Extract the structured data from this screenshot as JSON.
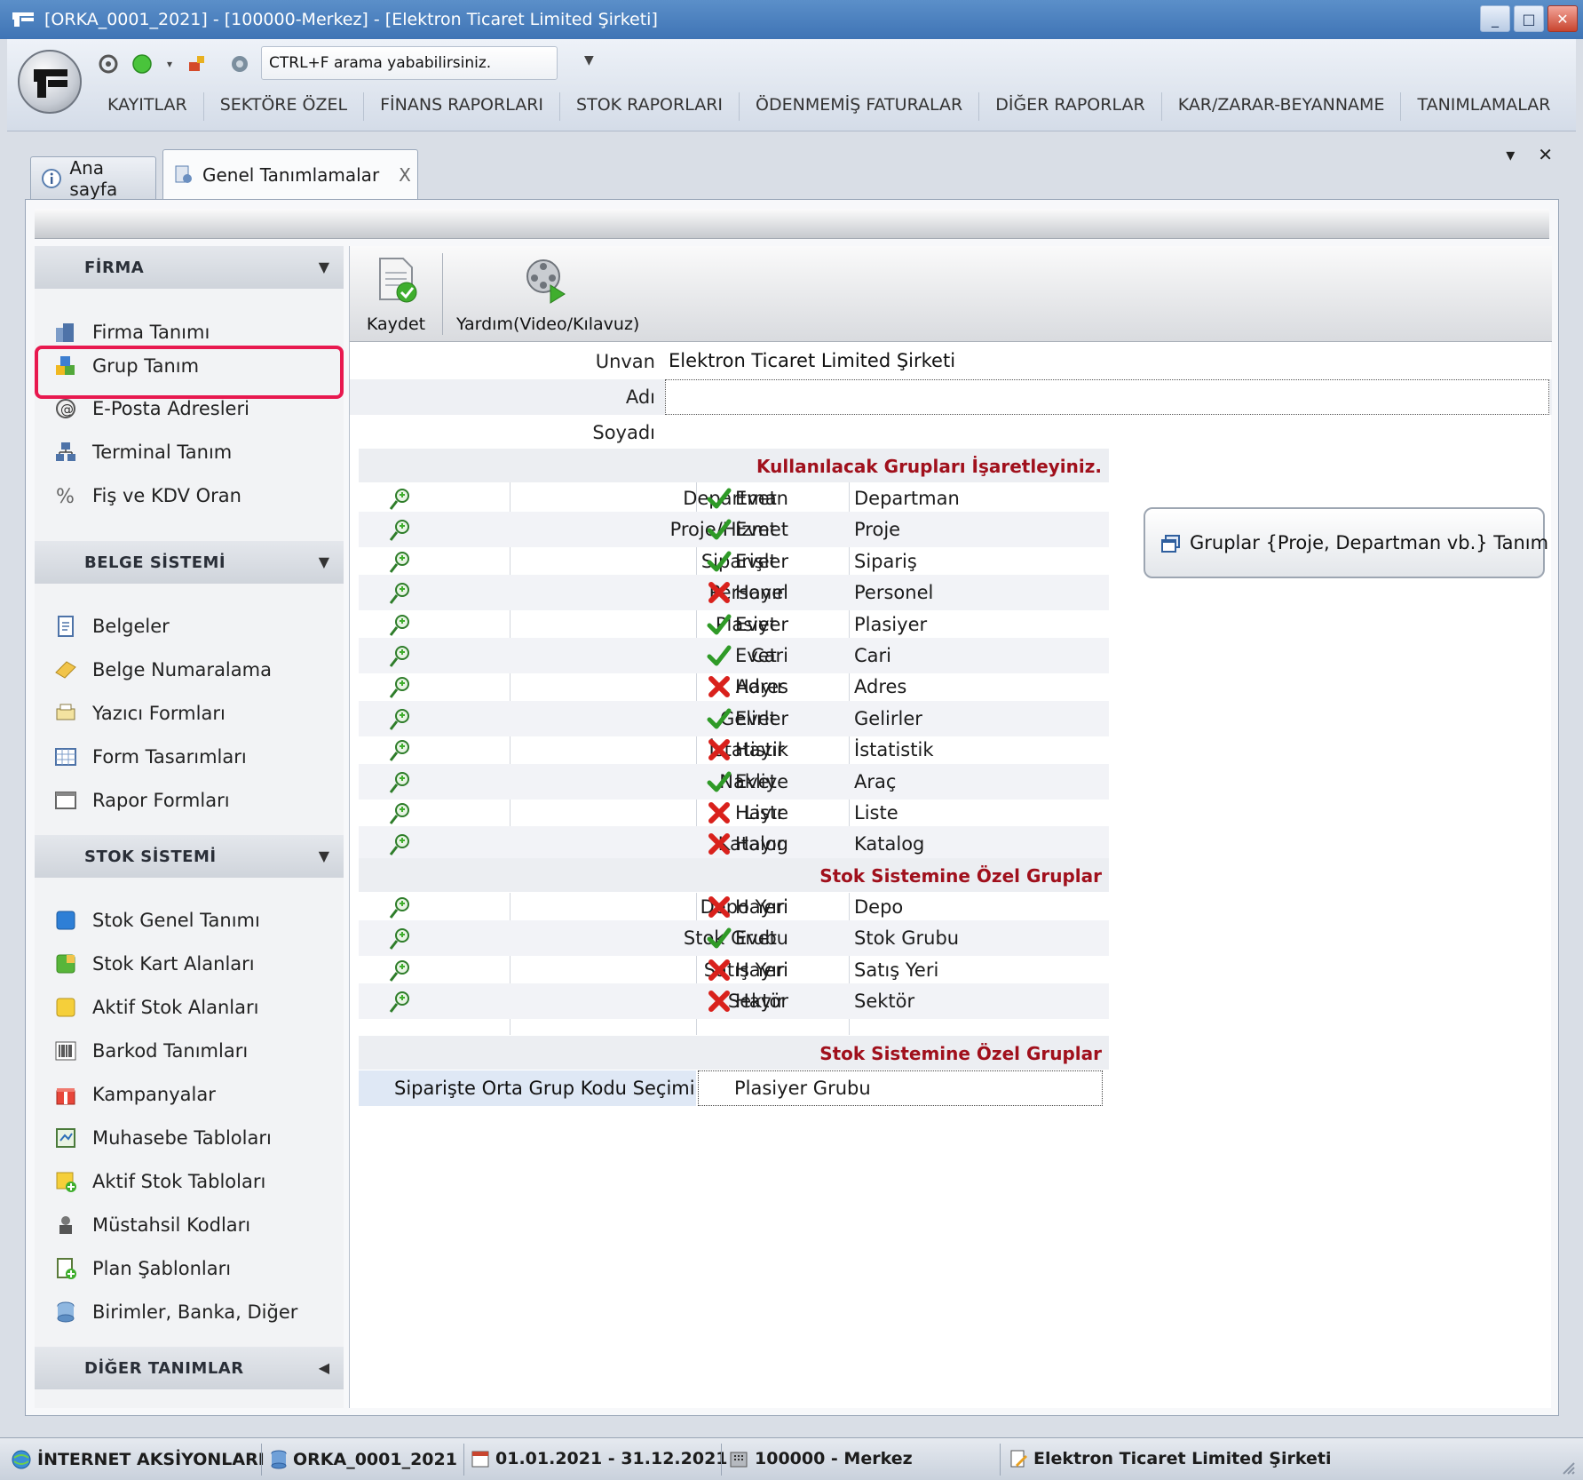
{
  "window": {
    "title": "[ORKA_0001_2021]  -  [100000-Merkez]  -  [Elektron Ticaret Limited Şirketi]",
    "buttons": [
      "_",
      "□",
      "✕"
    ]
  },
  "quick_access": {
    "search_placeholder": "CTRL+F arama yababilirsiniz.",
    "more": "▼"
  },
  "menu": [
    "KAYITLAR",
    "SEKTÖRE ÖZEL",
    "FİNANS RAPORLARI",
    "STOK RAPORLARI",
    "ÖDENMEMİŞ FATURALAR",
    "DİĞER RAPORLAR",
    "KAR/ZARAR-BEYANNAME",
    "TANIMLAMALAR"
  ],
  "tabs": {
    "home": "Ana sayfa",
    "active": "Genel Tanımlamalar",
    "close": "X",
    "strip_menu": "▾",
    "strip_close": "✕"
  },
  "sidebar": {
    "sections": [
      {
        "title": "FİRMA",
        "arrow": "▼",
        "items": [
          "Firma Tanımı",
          "Grup Tanım",
          "E-Posta Adresleri",
          "Terminal Tanım",
          "Fiş ve KDV Oran"
        ]
      },
      {
        "title": "BELGE SİSTEMİ",
        "arrow": "▼",
        "items": [
          "Belgeler",
          "Belge Numaralama",
          "Yazıcı Formları",
          "Form Tasarımları",
          "Rapor Formları"
        ]
      },
      {
        "title": "STOK SİSTEMİ",
        "arrow": "▼",
        "items": [
          "Stok Genel Tanımı",
          "Stok Kart Alanları",
          "Aktif Stok Alanları",
          "Barkod Tanımları",
          "Kampanyalar",
          "Muhasebe Tabloları",
          "Aktif Stok Tabloları",
          "Müstahsil Kodları",
          "Plan Şablonları",
          "Birimler, Banka, Diğer"
        ]
      },
      {
        "title": "DİĞER TANIMLAR",
        "arrow": "◀",
        "items": []
      }
    ],
    "highlighted": "Grup Tanım"
  },
  "toolbar": {
    "save_label": "Kaydet",
    "help_label": "Yardım(Video/Kılavuz)"
  },
  "form": {
    "unvan_label": "Unvan",
    "unvan_value": "Elektron Ticaret Limited Şirketi",
    "adi_label": "Adı",
    "adi_value": "",
    "soyadi_label": "Soyadı",
    "soyadi_value": ""
  },
  "groups": {
    "header": "Kullanılacak Grupları İşaretleyiniz.",
    "rows": [
      {
        "name": "Departman",
        "status": "Evet",
        "display": "Departman"
      },
      {
        "name": "Proje/Hizmet",
        "status": "Evet",
        "display": "Proje"
      },
      {
        "name": "Siparişler",
        "status": "Evet",
        "display": "Sipariş"
      },
      {
        "name": "Personel",
        "status": "Hayır",
        "display": "Personel"
      },
      {
        "name": "Plasiyer",
        "status": "Evet",
        "display": "Plasiyer"
      },
      {
        "name": "Cari",
        "status": "Evet",
        "display": "Cari"
      },
      {
        "name": "Adres",
        "status": "Hayır",
        "display": "Adres"
      },
      {
        "name": "Gelirler",
        "status": "Evet",
        "display": "Gelirler"
      },
      {
        "name": "İstatistik",
        "status": "Hayır",
        "display": "İstatistik"
      },
      {
        "name": "Nakliye",
        "status": "Evet",
        "display": "Araç"
      },
      {
        "name": "Liste",
        "status": "Hayır",
        "display": "Liste"
      },
      {
        "name": "Katalog",
        "status": "Hayır",
        "display": "Katalog"
      }
    ],
    "stock_header": "Stok Sistemine Özel Gruplar",
    "stock_rows": [
      {
        "name": "Depo Yeri",
        "status": "Hayır",
        "display": "Depo"
      },
      {
        "name": "Stok Grubu",
        "status": "Evet",
        "display": "Stok Grubu"
      },
      {
        "name": "Satış Yeri",
        "status": "Hayır",
        "display": "Satış Yeri"
      },
      {
        "name": "Sektör",
        "status": "Hayır",
        "display": "Sektör"
      }
    ],
    "stock_header_2": "Stok Sistemine Özel Gruplar",
    "order_label": "Siparişte Orta Grup Kodu Seçimi",
    "order_value": "Plasiyer Grubu"
  },
  "groups_button": "Gruplar {Proje, Departman vb.} Tanım",
  "statusbar": {
    "internet": "İNTERNET AKSİYONLARI",
    "db": "ORKA_0001_2021",
    "period": "01.01.2021 - 31.12.2021",
    "branch": "100000 - Merkez",
    "company": "Elektron Ticaret Limited Şirketi"
  },
  "colors": {
    "accent_red": "#a0101c",
    "highlight_border": "#e8194f",
    "check_green": "#2f9a27",
    "cross_red": "#d9211c"
  }
}
